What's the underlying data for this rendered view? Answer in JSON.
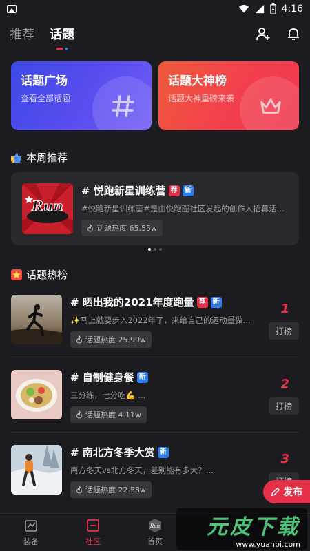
{
  "status_bar": {
    "time": "4:16"
  },
  "top_nav": {
    "tabs": [
      {
        "label": "推荐",
        "active": false
      },
      {
        "label": "话题",
        "active": true
      }
    ],
    "actions": [
      "add-friend-icon",
      "bell-icon"
    ]
  },
  "feature_cards": [
    {
      "title": "话题广场",
      "subtitle": "查看全部话题",
      "color": "#4c4ae9",
      "icon": "hash-icon"
    },
    {
      "title": "话题大神榜",
      "subtitle": "话题大神重磅来袭",
      "color": "#f0444a",
      "icon": "crown-icon"
    }
  ],
  "weekly": {
    "heading": "本周推荐",
    "item": {
      "title": "# 悦跑新星训练营",
      "badges": [
        "荐",
        "新"
      ],
      "desc": "#悦跑新星训练营#是由悦跑圈社区发起的创作人招募活...",
      "heat": "话题热度 65.55w"
    }
  },
  "hot": {
    "heading": "话题热榜",
    "rank_label": "打榜",
    "items": [
      {
        "rank": "1",
        "title": "# 晒出我的2021年度跑量",
        "badges": [
          "荐",
          "新"
        ],
        "desc": "✨马上就要步入2022年了，来给自己的运动量做...",
        "heat": "话题热度 25.99w"
      },
      {
        "rank": "2",
        "title": "# 自制健身餐",
        "badges": [
          "新"
        ],
        "desc": "三分练，七分吃💪 ...",
        "heat": "话题热度 4.11w"
      },
      {
        "rank": "3",
        "title": "# 南北方冬季大赏",
        "badges": [
          "新"
        ],
        "desc": "南方冬天vs北方冬天，差别能有多大？...",
        "heat": "话题热度 22.58w"
      }
    ]
  },
  "fab": {
    "label": "发布"
  },
  "bottom_nav": [
    {
      "label": "装备",
      "active": false
    },
    {
      "label": "社区",
      "active": true
    },
    {
      "label": "首页",
      "active": false
    },
    {
      "label": "",
      "active": false
    },
    {
      "label": "",
      "active": false
    }
  ],
  "watermark": {
    "main": "元皮下载",
    "sub": "www.yuanpi.com"
  },
  "colors": {
    "accent": "#e6304a",
    "badge_new": "#2b7ef0",
    "background": "#1c1c20",
    "card": "#28282d"
  }
}
